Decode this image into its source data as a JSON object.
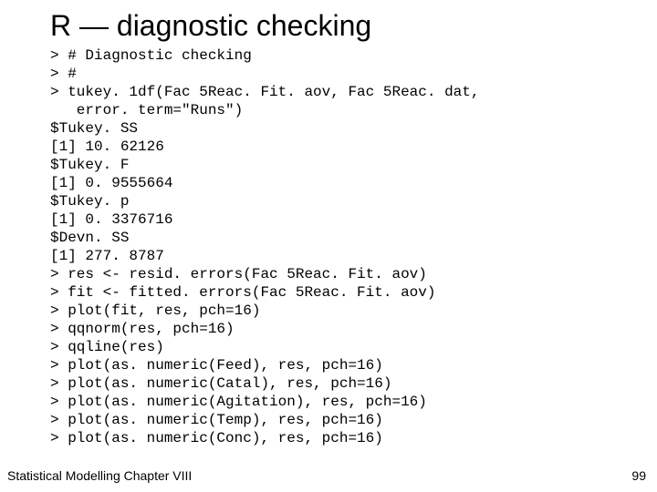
{
  "title": "R — diagnostic checking",
  "code": "> # Diagnostic checking\n> #\n> tukey. 1df(Fac 5Reac. Fit. aov, Fac 5Reac. dat,\n   error. term=\"Runs\")\n$Tukey. SS\n[1] 10. 62126\n$Tukey. F\n[1] 0. 9555664\n$Tukey. p\n[1] 0. 3376716\n$Devn. SS\n[1] 277. 8787\n> res <- resid. errors(Fac 5Reac. Fit. aov)\n> fit <- fitted. errors(Fac 5Reac. Fit. aov)\n> plot(fit, res, pch=16)\n> qqnorm(res, pch=16)\n> qqline(res)\n> plot(as. numeric(Feed), res, pch=16)\n> plot(as. numeric(Catal), res, pch=16)\n> plot(as. numeric(Agitation), res, pch=16)\n> plot(as. numeric(Temp), res, pch=16)\n> plot(as. numeric(Conc), res, pch=16)",
  "footer": {
    "left": "Statistical Modelling   Chapter VIII",
    "right": "99"
  }
}
